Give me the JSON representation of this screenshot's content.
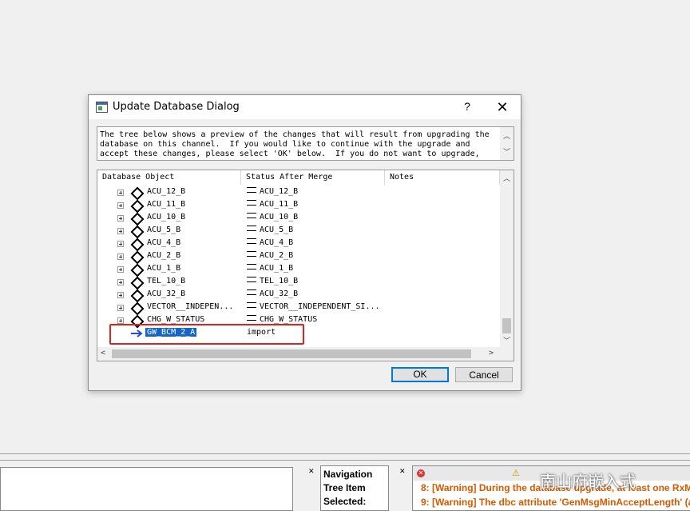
{
  "dialog": {
    "title": "Update Database Dialog",
    "help": "?",
    "close": "✕",
    "description": "The tree below shows a preview of the changes that will result from upgrading the database on this channel.  If you would like to continue with the upgrade and accept these changes, please select 'OK' below.  If you do not want to upgrade,",
    "columns": [
      "Database Object",
      "Status After Merge",
      "Notes"
    ],
    "rows": [
      {
        "name": "ACU_12_B",
        "status": "ACU_12_B"
      },
      {
        "name": "ACU_11_B",
        "status": "ACU_11_B"
      },
      {
        "name": "ACU_10_B",
        "status": "ACU_10_B"
      },
      {
        "name": "ACU_5_B",
        "status": "ACU_5_B"
      },
      {
        "name": "ACU_4_B",
        "status": "ACU_4_B"
      },
      {
        "name": "ACU_2_B",
        "status": "ACU_2_B"
      },
      {
        "name": "ACU_1_B",
        "status": "ACU_1_B"
      },
      {
        "name": "TEL_10_B",
        "status": "TEL_10_B"
      },
      {
        "name": "ACU_32_B",
        "status": "ACU_32_B"
      },
      {
        "name": "VECTOR__INDEPEN...",
        "status": "VECTOR__INDEPENDENT_SI..."
      },
      {
        "name": "CHG_W_STATUS",
        "status": "CHG_W_STATUS"
      },
      {
        "name": "GW_BCM_2_A",
        "status": "import",
        "selected": true
      }
    ],
    "ok_label": "OK",
    "cancel_label": "Cancel"
  },
  "bottom": {
    "navigation": [
      "Navigation",
      "Tree Item",
      "Selected:"
    ],
    "messages": [
      "8: [Warning] During the database upgrade, at least one RxM",
      "9: [Warning] The dbc attribute 'GenMsgMinAcceptLength' (a"
    ],
    "watermark": "南山府嵌入式"
  },
  "colors": {
    "selection": "#1664c4",
    "highlight": "#e0221f",
    "warning_text": "#d55a00"
  }
}
